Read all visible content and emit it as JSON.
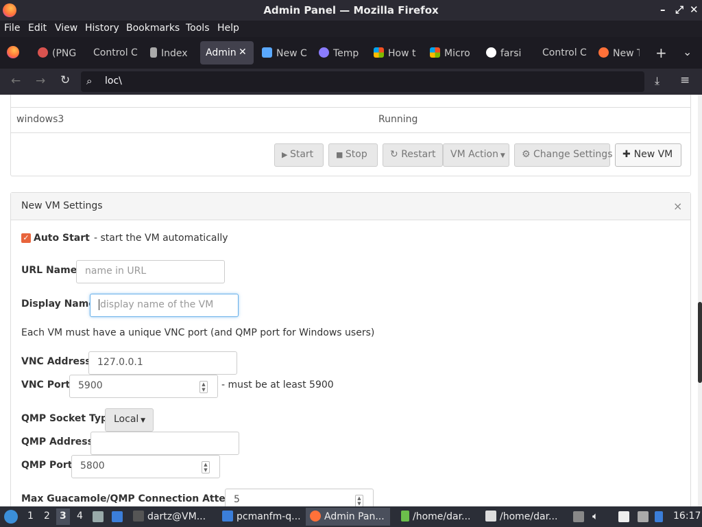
{
  "window": {
    "title": "Admin Panel — Mozilla Firefox"
  },
  "menubar": [
    "File",
    "Edit",
    "View",
    "History",
    "Bookmarks",
    "Tools",
    "Help"
  ],
  "tabs": [
    {
      "label": "(PNG",
      "color": "#d9534f"
    },
    {
      "label": "Control C",
      "color": ""
    },
    {
      "label": "Index",
      "color": "#aaa"
    },
    {
      "label": "Admin",
      "color": "",
      "active": true
    },
    {
      "label": "New C",
      "color": "#5aa9ff"
    },
    {
      "label": "Temp",
      "color": "#8a7cff"
    },
    {
      "label": "How t",
      "color": "#f25022"
    },
    {
      "label": "Micro",
      "color": "#f25022"
    },
    {
      "label": "farsi",
      "color": "#fff"
    },
    {
      "label": "Control C",
      "color": ""
    },
    {
      "label": "New T",
      "color": "#ff7139"
    }
  ],
  "urlbar": {
    "value": "loc\\"
  },
  "vm_row": {
    "name": "windows3",
    "status": "Running"
  },
  "toolbar": {
    "start": "Start",
    "stop": "Stop",
    "restart": "Restart",
    "vm_action": "VM Action",
    "change_settings": "Change Settings",
    "new_vm": "New VM"
  },
  "settings": {
    "title": "New VM Settings",
    "close": "×",
    "auto_start_label": "Auto Start",
    "auto_start_desc": "- start the VM automatically",
    "auto_start_checked": true,
    "url_name_label": "URL Name:",
    "url_name_placeholder": "name in URL",
    "display_name_label": "Display Name:",
    "display_name_placeholder": "display name of the VM",
    "vnc_note": "Each VM must have a unique VNC port (and QMP port for Windows users)",
    "vnc_address_label": "VNC Address:",
    "vnc_address_value": "127.0.0.1",
    "vnc_port_label": "VNC Port:",
    "vnc_port_value": "5900",
    "vnc_port_note": "- must be at least 5900",
    "qmp_socket_label": "QMP Socket Type:",
    "qmp_socket_value": "Local",
    "qmp_address_label": "QMP Address:",
    "qmp_address_value": "",
    "qmp_port_label": "QMP Port:",
    "qmp_port_value": "5800",
    "max_attempts_label": "Max Guacamole/QMP Connection Attempts:",
    "max_attempts_value": "5"
  },
  "taskbar": {
    "workspaces": [
      "1",
      "2",
      "3",
      "4"
    ],
    "active_workspace": "3",
    "items": [
      "dartz@VM...",
      "pcmanfm-q...",
      "Admin Pan...",
      "/home/dar...",
      "/home/dar..."
    ],
    "clock": "16:17"
  },
  "colors": {
    "accent": "#e8643c",
    "chrome_dark": "#1c1b22",
    "taskbar": "#2b2e37"
  }
}
